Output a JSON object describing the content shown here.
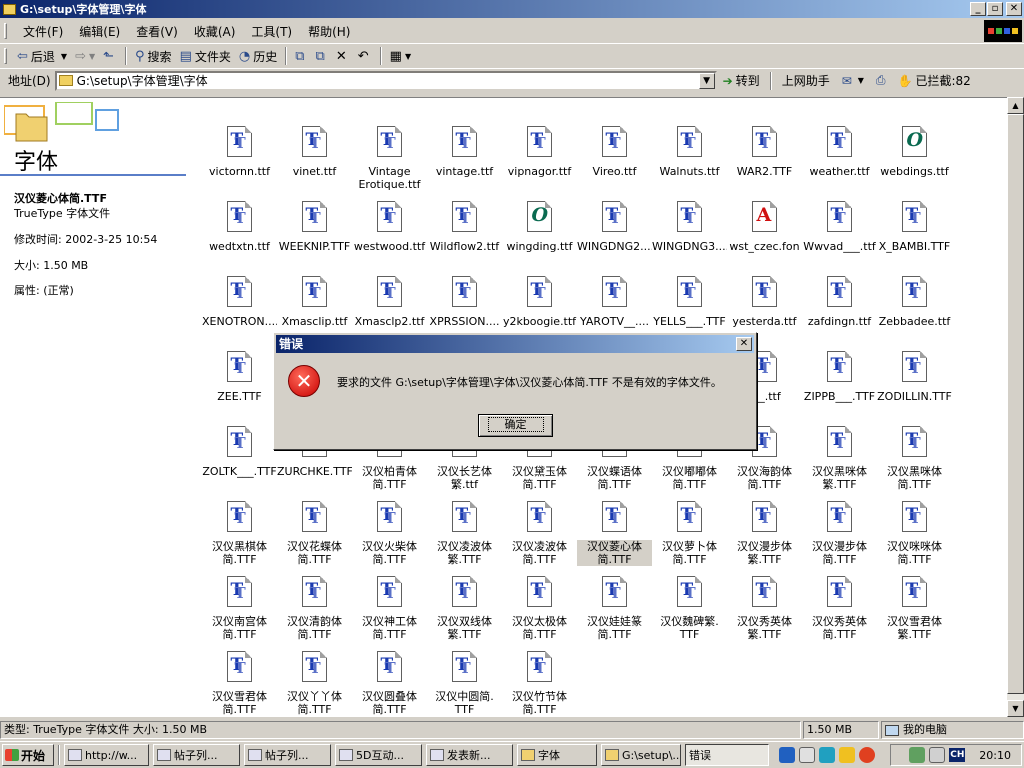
{
  "window": {
    "title": "G:\\setup\\字体管理\\字体"
  },
  "menu": [
    "文件(F)",
    "编辑(E)",
    "查看(V)",
    "收藏(A)",
    "工具(T)",
    "帮助(H)"
  ],
  "toolbar": {
    "back": "后退",
    "search": "搜索",
    "folders": "文件夹",
    "history": "历史"
  },
  "address": {
    "label": "地址(D)",
    "value": "G:\\setup\\字体管理\\字体",
    "go": "转到",
    "assistant": "上网助手",
    "blocked": "已拦截:82"
  },
  "left_panel": {
    "title": "字体",
    "file_name": "汉仪菱心体简.TTF",
    "file_type": "TrueType 字体文件",
    "modified": "修改时间: 2002-3-25 10:54",
    "size": "大小: 1.50 MB",
    "attributes": "属性: (正常)"
  },
  "files": [
    {
      "name": "victornn.ttf",
      "icon": "tt"
    },
    {
      "name": "vinet.ttf",
      "icon": "tt"
    },
    {
      "name": "Vintage\nErotique.ttf",
      "icon": "tt"
    },
    {
      "name": "vintage.ttf",
      "icon": "tt"
    },
    {
      "name": "vipnagor.ttf",
      "icon": "tt"
    },
    {
      "name": "Vireo.ttf",
      "icon": "tt"
    },
    {
      "name": "Walnuts.ttf",
      "icon": "tt"
    },
    {
      "name": "WAR2.TTF",
      "icon": "tt"
    },
    {
      "name": "weather.ttf",
      "icon": "tt"
    },
    {
      "name": "webdings.ttf",
      "icon": "o"
    },
    {
      "name": "wedtxtn.ttf",
      "icon": "tt"
    },
    {
      "name": "WEEKNIP.TTF",
      "icon": "tt"
    },
    {
      "name": "westwood.ttf",
      "icon": "tt"
    },
    {
      "name": "Wildflow2.ttf",
      "icon": "tt"
    },
    {
      "name": "wingding.ttf",
      "icon": "o"
    },
    {
      "name": "WINGDNG2....",
      "icon": "tt"
    },
    {
      "name": "WINGDNG3....",
      "icon": "tt"
    },
    {
      "name": "wst_czec.fon",
      "icon": "a"
    },
    {
      "name": "Wwvad___.ttf",
      "icon": "tt"
    },
    {
      "name": "X_BAMBI.TTF",
      "icon": "tt"
    },
    {
      "name": "XENOTRON....",
      "icon": "tt"
    },
    {
      "name": "Xmasclip.ttf",
      "icon": "tt"
    },
    {
      "name": "Xmasclp2.ttf",
      "icon": "tt"
    },
    {
      "name": "XPRSSION....",
      "icon": "tt"
    },
    {
      "name": "y2kboogie.ttf",
      "icon": "tt"
    },
    {
      "name": "YAROTV__....",
      "icon": "tt"
    },
    {
      "name": "YELLS___.TTF",
      "icon": "tt"
    },
    {
      "name": "yesterda.ttf",
      "icon": "tt"
    },
    {
      "name": "zafdingn.ttf",
      "icon": "tt"
    },
    {
      "name": "Zebbadee.ttf",
      "icon": "tt"
    },
    {
      "name": "ZEE.TTF",
      "icon": "tt"
    },
    {
      "name": "",
      "icon": "none"
    },
    {
      "name": "",
      "icon": "none"
    },
    {
      "name": "",
      "icon": "none"
    },
    {
      "name": "",
      "icon": "none"
    },
    {
      "name": "",
      "icon": "none"
    },
    {
      "name": "",
      "icon": "none"
    },
    {
      "name": "___.ttf",
      "icon": "tt"
    },
    {
      "name": "ZIPPB___.TTF",
      "icon": "tt"
    },
    {
      "name": "ZODILLIN.TTF",
      "icon": "tt"
    },
    {
      "name": "ZOLTK___.TTF",
      "icon": "tt"
    },
    {
      "name": "ZURCHKE.TTF",
      "icon": "tt"
    },
    {
      "name": "汉仪柏青体\n简.TTF",
      "icon": "tt"
    },
    {
      "name": "汉仪长艺体\n繁.ttf",
      "icon": "tt"
    },
    {
      "name": "汉仪黛玉体\n简.TTF",
      "icon": "tt"
    },
    {
      "name": "汉仪蝶语体\n简.TTF",
      "icon": "tt"
    },
    {
      "name": "汉仪嘟嘟体\n简.TTF",
      "icon": "tt"
    },
    {
      "name": "汉仪海韵体\n简.TTF",
      "icon": "tt"
    },
    {
      "name": "汉仪黑咪体\n繁.TTF",
      "icon": "tt"
    },
    {
      "name": "汉仪黑咪体\n简.TTF",
      "icon": "tt"
    },
    {
      "name": "汉仪黑棋体\n简.TTF",
      "icon": "tt"
    },
    {
      "name": "汉仪花蝶体\n简.TTF",
      "icon": "tt"
    },
    {
      "name": "汉仪火柴体\n简.TTF",
      "icon": "tt"
    },
    {
      "name": "汉仪凌波体\n繁.TTF",
      "icon": "tt"
    },
    {
      "name": "汉仪凌波体\n简.TTF",
      "icon": "tt"
    },
    {
      "name": "汉仪菱心体\n简.TTF",
      "icon": "tt",
      "selected": true
    },
    {
      "name": "汉仪萝卜体\n简.TTF",
      "icon": "tt"
    },
    {
      "name": "汉仪漫步体\n繁.TTF",
      "icon": "tt"
    },
    {
      "name": "汉仪漫步体\n简.TTF",
      "icon": "tt"
    },
    {
      "name": "汉仪咪咪体\n简.TTF",
      "icon": "tt"
    },
    {
      "name": "汉仪南宫体\n简.TTF",
      "icon": "tt"
    },
    {
      "name": "汉仪清韵体\n简.TTF",
      "icon": "tt"
    },
    {
      "name": "汉仪神工体\n简.TTF",
      "icon": "tt"
    },
    {
      "name": "汉仪双线体\n繁.TTF",
      "icon": "tt"
    },
    {
      "name": "汉仪太极体\n简.TTF",
      "icon": "tt"
    },
    {
      "name": "汉仪娃娃篆\n简.TTF",
      "icon": "tt"
    },
    {
      "name": "汉仪魏碑繁.\nTTF",
      "icon": "tt"
    },
    {
      "name": "汉仪秀英体\n繁.TTF",
      "icon": "tt"
    },
    {
      "name": "汉仪秀英体\n简.TTF",
      "icon": "tt"
    },
    {
      "name": "汉仪雪君体\n繁.TTF",
      "icon": "tt"
    },
    {
      "name": "汉仪雪君体\n简.TTF",
      "icon": "tt"
    },
    {
      "name": "汉仪丫丫体\n简.TTF",
      "icon": "tt"
    },
    {
      "name": "汉仪圆叠体\n简.TTF",
      "icon": "tt"
    },
    {
      "name": "汉仪中圆简.\nTTF",
      "icon": "tt"
    },
    {
      "name": "汉仪竹节体\n简.TTF",
      "icon": "tt"
    }
  ],
  "dialog": {
    "title": "错误",
    "message": "要求的文件 G:\\setup\\字体管理\\字体\\汉仪菱心体简.TTF 不是有效的字体文件。",
    "ok": "确定"
  },
  "status": {
    "text": "类型: TrueType 字体文件 大小: 1.50 MB",
    "size": "1.50 MB",
    "location": "我的电脑"
  },
  "taskbar": {
    "start": "开始",
    "tasks": [
      "http://w...",
      "帖子列...",
      "帖子列...",
      "5D互动...",
      "发表新...",
      "字体",
      "G:\\setup\\...",
      "错误"
    ],
    "ime": "CH",
    "clock": "20:10"
  }
}
